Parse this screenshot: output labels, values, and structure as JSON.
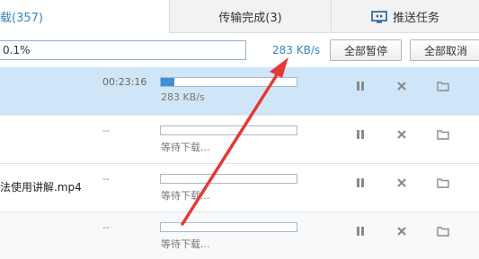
{
  "tabs": [
    {
      "label": "载(357)",
      "active": true
    },
    {
      "label": "传输完成(3)",
      "active": false
    },
    {
      "label": "推送任务",
      "active": false,
      "icon": "monitor-icon"
    }
  ],
  "toolbar": {
    "search_value": "0.1%",
    "total_speed": "283 KB/s",
    "pause_all_label": "全部暂停",
    "cancel_all_label": "全部取消"
  },
  "rows": [
    {
      "name": "",
      "time": "00:23:16",
      "progress": 0.1,
      "sub": "283 KB/s",
      "selected": true
    },
    {
      "name": "",
      "time": "--",
      "progress": 0,
      "sub": "等待下载...",
      "selected": false
    },
    {
      "name": "法使用讲解.mp4",
      "time": "--",
      "progress": 0,
      "sub": "等待下载...",
      "selected": false
    },
    {
      "name": "",
      "time": "--",
      "progress": 0,
      "sub": "等待下载...",
      "selected": false
    }
  ],
  "colors": {
    "accent": "#2f86c8",
    "selected_row": "#cfe6f8",
    "arrow": "#e53935"
  },
  "icons": [
    "monitor-icon",
    "pause-icon",
    "close-icon",
    "folder-icon",
    "arrow-annotation"
  ]
}
